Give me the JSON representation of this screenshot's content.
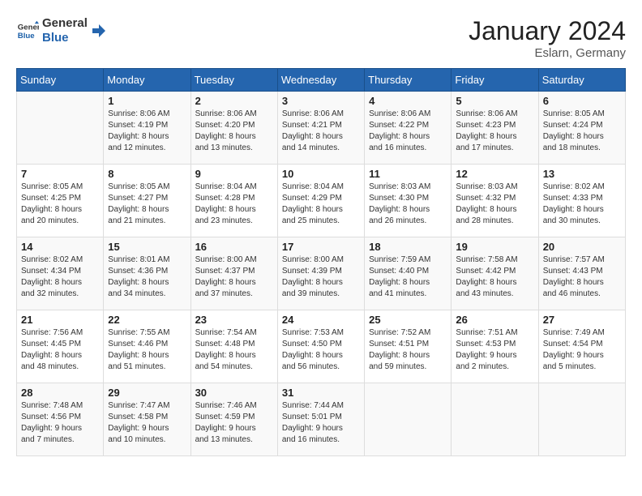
{
  "logo": {
    "line1": "General",
    "line2": "Blue"
  },
  "title": "January 2024",
  "location": "Eslarn, Germany",
  "weekdays": [
    "Sunday",
    "Monday",
    "Tuesday",
    "Wednesday",
    "Thursday",
    "Friday",
    "Saturday"
  ],
  "weeks": [
    [
      {
        "day": "",
        "info": ""
      },
      {
        "day": "1",
        "info": "Sunrise: 8:06 AM\nSunset: 4:19 PM\nDaylight: 8 hours\nand 12 minutes."
      },
      {
        "day": "2",
        "info": "Sunrise: 8:06 AM\nSunset: 4:20 PM\nDaylight: 8 hours\nand 13 minutes."
      },
      {
        "day": "3",
        "info": "Sunrise: 8:06 AM\nSunset: 4:21 PM\nDaylight: 8 hours\nand 14 minutes."
      },
      {
        "day": "4",
        "info": "Sunrise: 8:06 AM\nSunset: 4:22 PM\nDaylight: 8 hours\nand 16 minutes."
      },
      {
        "day": "5",
        "info": "Sunrise: 8:06 AM\nSunset: 4:23 PM\nDaylight: 8 hours\nand 17 minutes."
      },
      {
        "day": "6",
        "info": "Sunrise: 8:05 AM\nSunset: 4:24 PM\nDaylight: 8 hours\nand 18 minutes."
      }
    ],
    [
      {
        "day": "7",
        "info": "Sunrise: 8:05 AM\nSunset: 4:25 PM\nDaylight: 8 hours\nand 20 minutes."
      },
      {
        "day": "8",
        "info": "Sunrise: 8:05 AM\nSunset: 4:27 PM\nDaylight: 8 hours\nand 21 minutes."
      },
      {
        "day": "9",
        "info": "Sunrise: 8:04 AM\nSunset: 4:28 PM\nDaylight: 8 hours\nand 23 minutes."
      },
      {
        "day": "10",
        "info": "Sunrise: 8:04 AM\nSunset: 4:29 PM\nDaylight: 8 hours\nand 25 minutes."
      },
      {
        "day": "11",
        "info": "Sunrise: 8:03 AM\nSunset: 4:30 PM\nDaylight: 8 hours\nand 26 minutes."
      },
      {
        "day": "12",
        "info": "Sunrise: 8:03 AM\nSunset: 4:32 PM\nDaylight: 8 hours\nand 28 minutes."
      },
      {
        "day": "13",
        "info": "Sunrise: 8:02 AM\nSunset: 4:33 PM\nDaylight: 8 hours\nand 30 minutes."
      }
    ],
    [
      {
        "day": "14",
        "info": "Sunrise: 8:02 AM\nSunset: 4:34 PM\nDaylight: 8 hours\nand 32 minutes."
      },
      {
        "day": "15",
        "info": "Sunrise: 8:01 AM\nSunset: 4:36 PM\nDaylight: 8 hours\nand 34 minutes."
      },
      {
        "day": "16",
        "info": "Sunrise: 8:00 AM\nSunset: 4:37 PM\nDaylight: 8 hours\nand 37 minutes."
      },
      {
        "day": "17",
        "info": "Sunrise: 8:00 AM\nSunset: 4:39 PM\nDaylight: 8 hours\nand 39 minutes."
      },
      {
        "day": "18",
        "info": "Sunrise: 7:59 AM\nSunset: 4:40 PM\nDaylight: 8 hours\nand 41 minutes."
      },
      {
        "day": "19",
        "info": "Sunrise: 7:58 AM\nSunset: 4:42 PM\nDaylight: 8 hours\nand 43 minutes."
      },
      {
        "day": "20",
        "info": "Sunrise: 7:57 AM\nSunset: 4:43 PM\nDaylight: 8 hours\nand 46 minutes."
      }
    ],
    [
      {
        "day": "21",
        "info": "Sunrise: 7:56 AM\nSunset: 4:45 PM\nDaylight: 8 hours\nand 48 minutes."
      },
      {
        "day": "22",
        "info": "Sunrise: 7:55 AM\nSunset: 4:46 PM\nDaylight: 8 hours\nand 51 minutes."
      },
      {
        "day": "23",
        "info": "Sunrise: 7:54 AM\nSunset: 4:48 PM\nDaylight: 8 hours\nand 54 minutes."
      },
      {
        "day": "24",
        "info": "Sunrise: 7:53 AM\nSunset: 4:50 PM\nDaylight: 8 hours\nand 56 minutes."
      },
      {
        "day": "25",
        "info": "Sunrise: 7:52 AM\nSunset: 4:51 PM\nDaylight: 8 hours\nand 59 minutes."
      },
      {
        "day": "26",
        "info": "Sunrise: 7:51 AM\nSunset: 4:53 PM\nDaylight: 9 hours\nand 2 minutes."
      },
      {
        "day": "27",
        "info": "Sunrise: 7:49 AM\nSunset: 4:54 PM\nDaylight: 9 hours\nand 5 minutes."
      }
    ],
    [
      {
        "day": "28",
        "info": "Sunrise: 7:48 AM\nSunset: 4:56 PM\nDaylight: 9 hours\nand 7 minutes."
      },
      {
        "day": "29",
        "info": "Sunrise: 7:47 AM\nSunset: 4:58 PM\nDaylight: 9 hours\nand 10 minutes."
      },
      {
        "day": "30",
        "info": "Sunrise: 7:46 AM\nSunset: 4:59 PM\nDaylight: 9 hours\nand 13 minutes."
      },
      {
        "day": "31",
        "info": "Sunrise: 7:44 AM\nSunset: 5:01 PM\nDaylight: 9 hours\nand 16 minutes."
      },
      {
        "day": "",
        "info": ""
      },
      {
        "day": "",
        "info": ""
      },
      {
        "day": "",
        "info": ""
      }
    ]
  ]
}
